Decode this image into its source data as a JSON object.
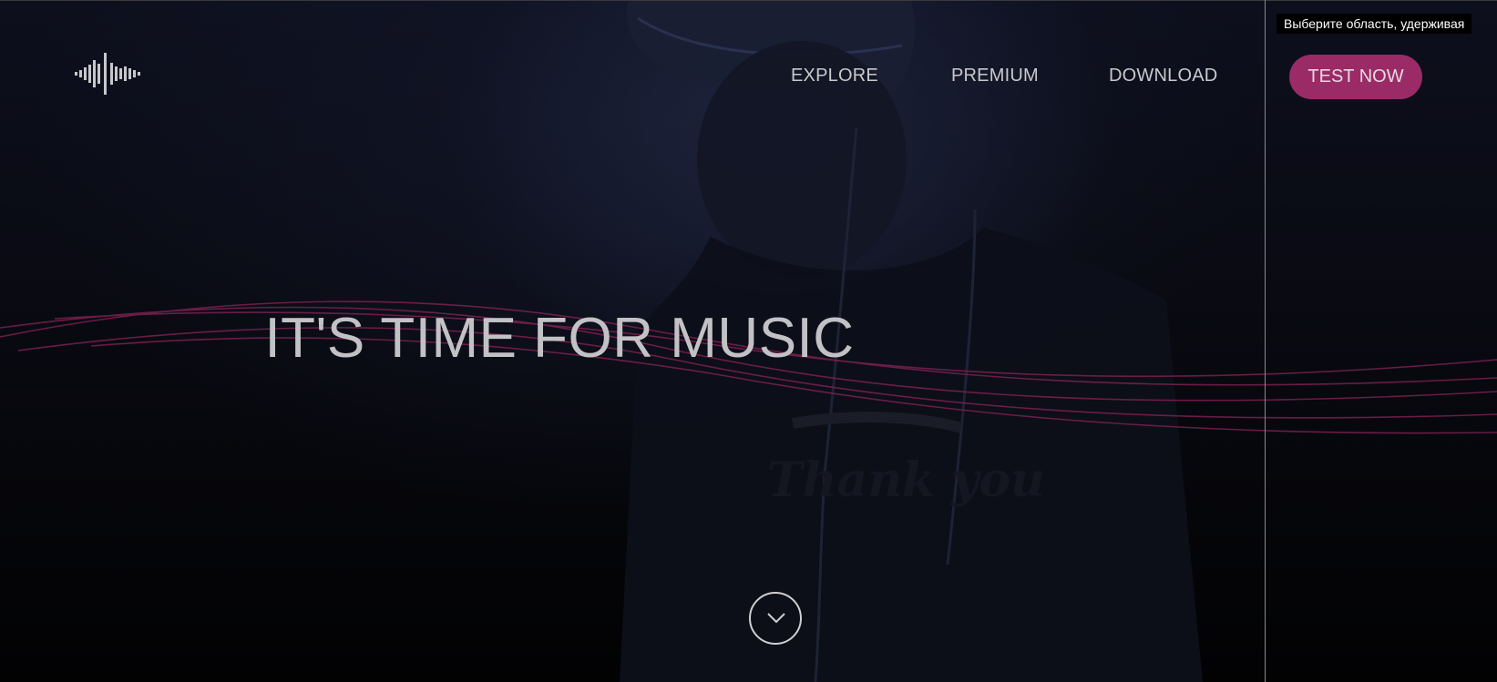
{
  "brand": {
    "logo_icon": "sound-wave-icon"
  },
  "nav": {
    "items": [
      {
        "label": "EXPLORE"
      },
      {
        "label": "PREMIUM"
      },
      {
        "label": "DOWNLOAD"
      }
    ],
    "cta_label": "TEST NOW"
  },
  "hero": {
    "headline": "IT'S TIME FOR MUSIC",
    "scroll_icon": "chevron-down-icon",
    "shirt_text": "Thank you"
  },
  "overlay": {
    "tooltip": "Выберите область, удерживая"
  },
  "colors": {
    "accent": "#9a2b67",
    "wave": "#8a2357",
    "text": "#c2c2c6"
  }
}
